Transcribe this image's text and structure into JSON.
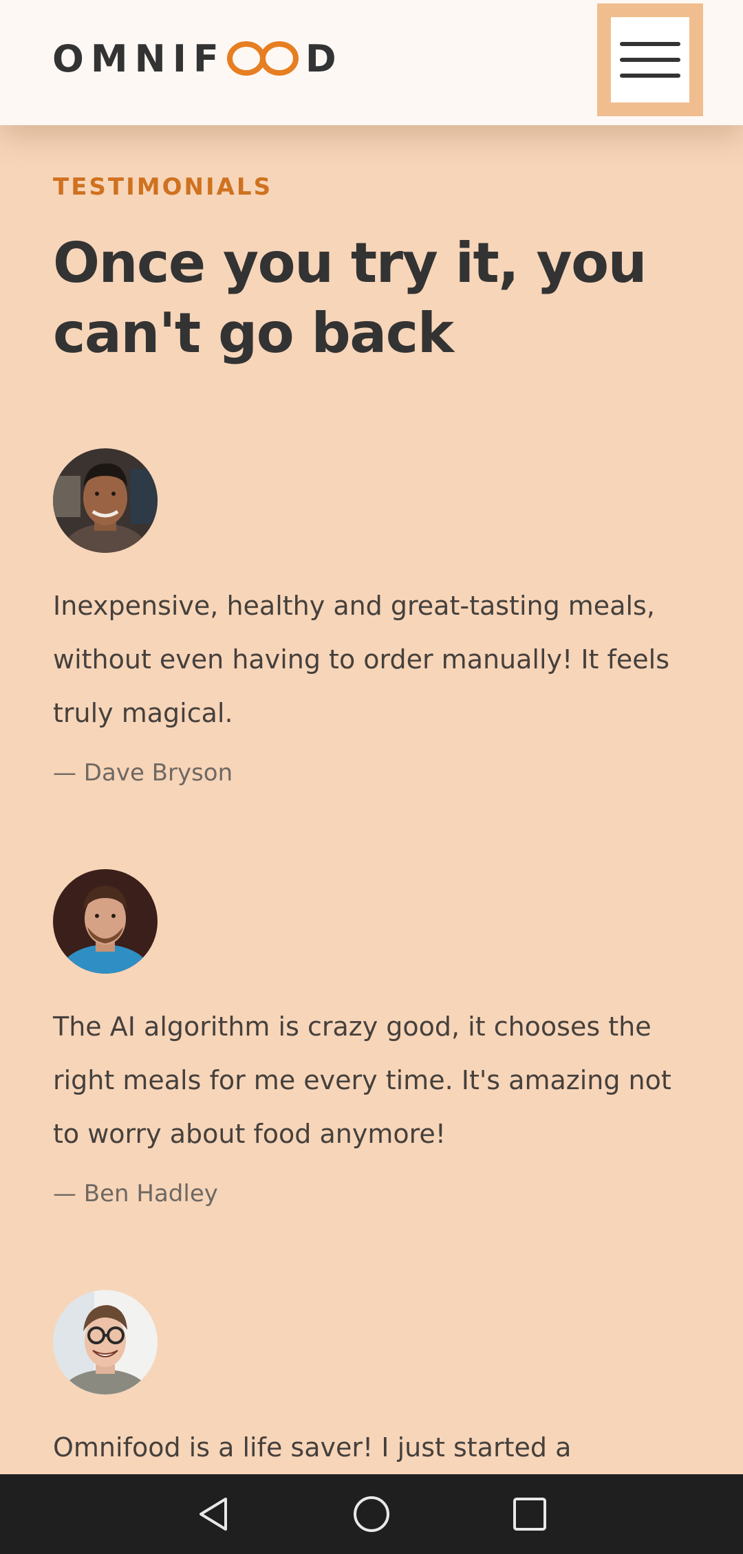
{
  "header": {
    "logo_left": "OMNIF",
    "logo_right": "D",
    "logo_alt": "OMNIFOOD",
    "menu_icon": "hamburger-menu-icon",
    "colors": {
      "brand_orange": "#e67e22",
      "menu_border": "#f0bd8f",
      "text_dark": "#333333"
    }
  },
  "section": {
    "eyebrow": "TESTIMONIALS",
    "heading": "Once you try it, you can't go back",
    "background": "#f7d5b9"
  },
  "testimonials": [
    {
      "avatar": "dave-bryson-photo",
      "quote": "Inexpensive, healthy and great-tasting meals, without even having to order manually! It feels truly magical.",
      "author": "— Dave Bryson"
    },
    {
      "avatar": "ben-hadley-photo",
      "quote": "The AI algorithm is crazy good, it chooses the right meals for me every time. It's amazing not to worry about food anymore!",
      "author": "— Ben Hadley"
    },
    {
      "avatar": "third-testimonial-photo",
      "quote": "Omnifood is a life saver! I just started a"
    }
  ],
  "system_nav": {
    "back_icon": "back-triangle-icon",
    "home_icon": "home-circle-icon",
    "recents_icon": "recents-square-icon"
  }
}
